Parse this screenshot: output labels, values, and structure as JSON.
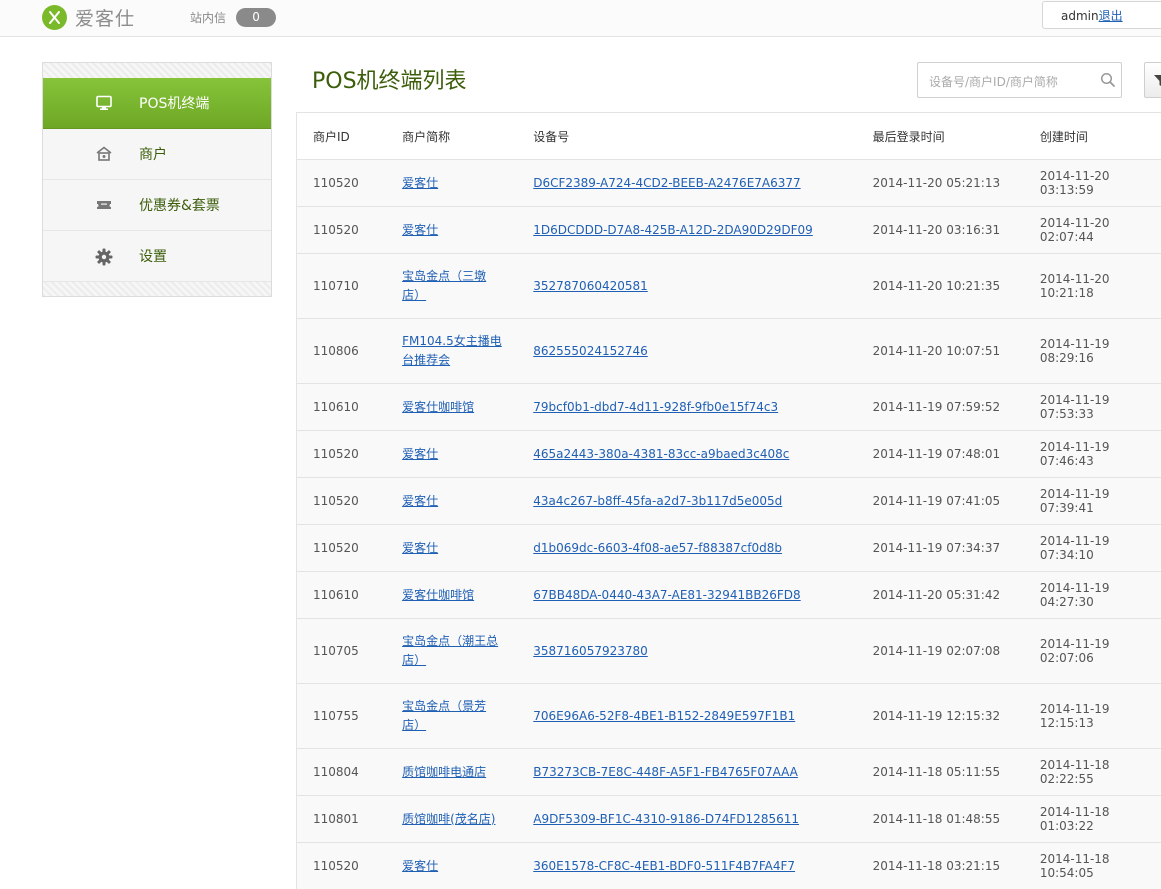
{
  "header": {
    "logo_text": "爱客仕",
    "inbox_label": "站内信",
    "inbox_count": "0",
    "username": "admin",
    "logout_label": "退出"
  },
  "sidebar": {
    "items": [
      {
        "label": "POS机终端",
        "icon": "monitor-icon",
        "active": true
      },
      {
        "label": "商户",
        "icon": "shop-icon",
        "active": false
      },
      {
        "label": "优惠券&套票",
        "icon": "coupon-icon",
        "active": false
      },
      {
        "label": "设置",
        "icon": "gear-icon",
        "active": false
      }
    ]
  },
  "main": {
    "title": "POS机终端列表",
    "search": {
      "placeholder": "设备号/商户ID/商户简称",
      "value": ""
    },
    "columns": [
      "商户ID",
      "商户简称",
      "设备号",
      "最后登录时间",
      "创建时间"
    ],
    "rows": [
      {
        "merchant_id": "110520",
        "name": "爱客仕",
        "device": "D6CF2389-A724-4CD2-BEEB-A2476E7A6377",
        "last_login": "2014-11-20 05:21:13",
        "created": "2014-11-20 03:13:59"
      },
      {
        "merchant_id": "110520",
        "name": "爱客仕",
        "device": "1D6DCDDD-D7A8-425B-A12D-2DA90D29DF09",
        "last_login": "2014-11-20 03:16:31",
        "created": "2014-11-20 02:07:44"
      },
      {
        "merchant_id": "110710",
        "name": "宝岛金点（三墩店）",
        "device": "352787060420581",
        "last_login": "2014-11-20 10:21:35",
        "created": "2014-11-20 10:21:18"
      },
      {
        "merchant_id": "110806",
        "name": "FM104.5女主播电台推荐会",
        "device": "862555024152746",
        "last_login": "2014-11-20 10:07:51",
        "created": "2014-11-19 08:29:16"
      },
      {
        "merchant_id": "110610",
        "name": "爱客仕咖啡馆",
        "device": "79bcf0b1-dbd7-4d11-928f-9fb0e15f74c3",
        "last_login": "2014-11-19 07:59:52",
        "created": "2014-11-19 07:53:33"
      },
      {
        "merchant_id": "110520",
        "name": "爱客仕",
        "device": "465a2443-380a-4381-83cc-a9baed3c408c",
        "last_login": "2014-11-19 07:48:01",
        "created": "2014-11-19 07:46:43"
      },
      {
        "merchant_id": "110520",
        "name": "爱客仕",
        "device": "43a4c267-b8ff-45fa-a2d7-3b117d5e005d",
        "last_login": "2014-11-19 07:41:05",
        "created": "2014-11-19 07:39:41"
      },
      {
        "merchant_id": "110520",
        "name": "爱客仕",
        "device": "d1b069dc-6603-4f08-ae57-f88387cf0d8b",
        "last_login": "2014-11-19 07:34:37",
        "created": "2014-11-19 07:34:10"
      },
      {
        "merchant_id": "110610",
        "name": "爱客仕咖啡馆",
        "device": "67BB48DA-0440-43A7-AE81-32941BB26FD8",
        "last_login": "2014-11-20 05:31:42",
        "created": "2014-11-19 04:27:30"
      },
      {
        "merchant_id": "110705",
        "name": "宝岛金点（潮王总店）",
        "device": "358716057923780",
        "last_login": "2014-11-19 02:07:08",
        "created": "2014-11-19 02:07:06"
      },
      {
        "merchant_id": "110755",
        "name": "宝岛金点（景芳店）",
        "device": "706E96A6-52F8-4BE1-B152-2849E597F1B1",
        "last_login": "2014-11-19 12:15:32",
        "created": "2014-11-19 12:15:13"
      },
      {
        "merchant_id": "110804",
        "name": "质馆咖啡电通店",
        "device": "B73273CB-7E8C-448F-A5F1-FB4765F07AAA",
        "last_login": "2014-11-18 05:11:55",
        "created": "2014-11-18 02:22:55"
      },
      {
        "merchant_id": "110801",
        "name": "质馆咖啡(茂名店)",
        "device": "A9DF5309-BF1C-4310-9186-D74FD1285611",
        "last_login": "2014-11-18 01:48:55",
        "created": "2014-11-18 01:03:22"
      },
      {
        "merchant_id": "110520",
        "name": "爱客仕",
        "device": "360E1578-CF8C-4EB1-BDF0-511F4B7FA4F7",
        "last_login": "2014-11-18 03:21:15",
        "created": "2014-11-18 10:54:05"
      }
    ]
  },
  "colors": {
    "brand_green": "#7ab929",
    "title_green": "#3c5e0b",
    "link_blue": "#1f5fb4"
  }
}
